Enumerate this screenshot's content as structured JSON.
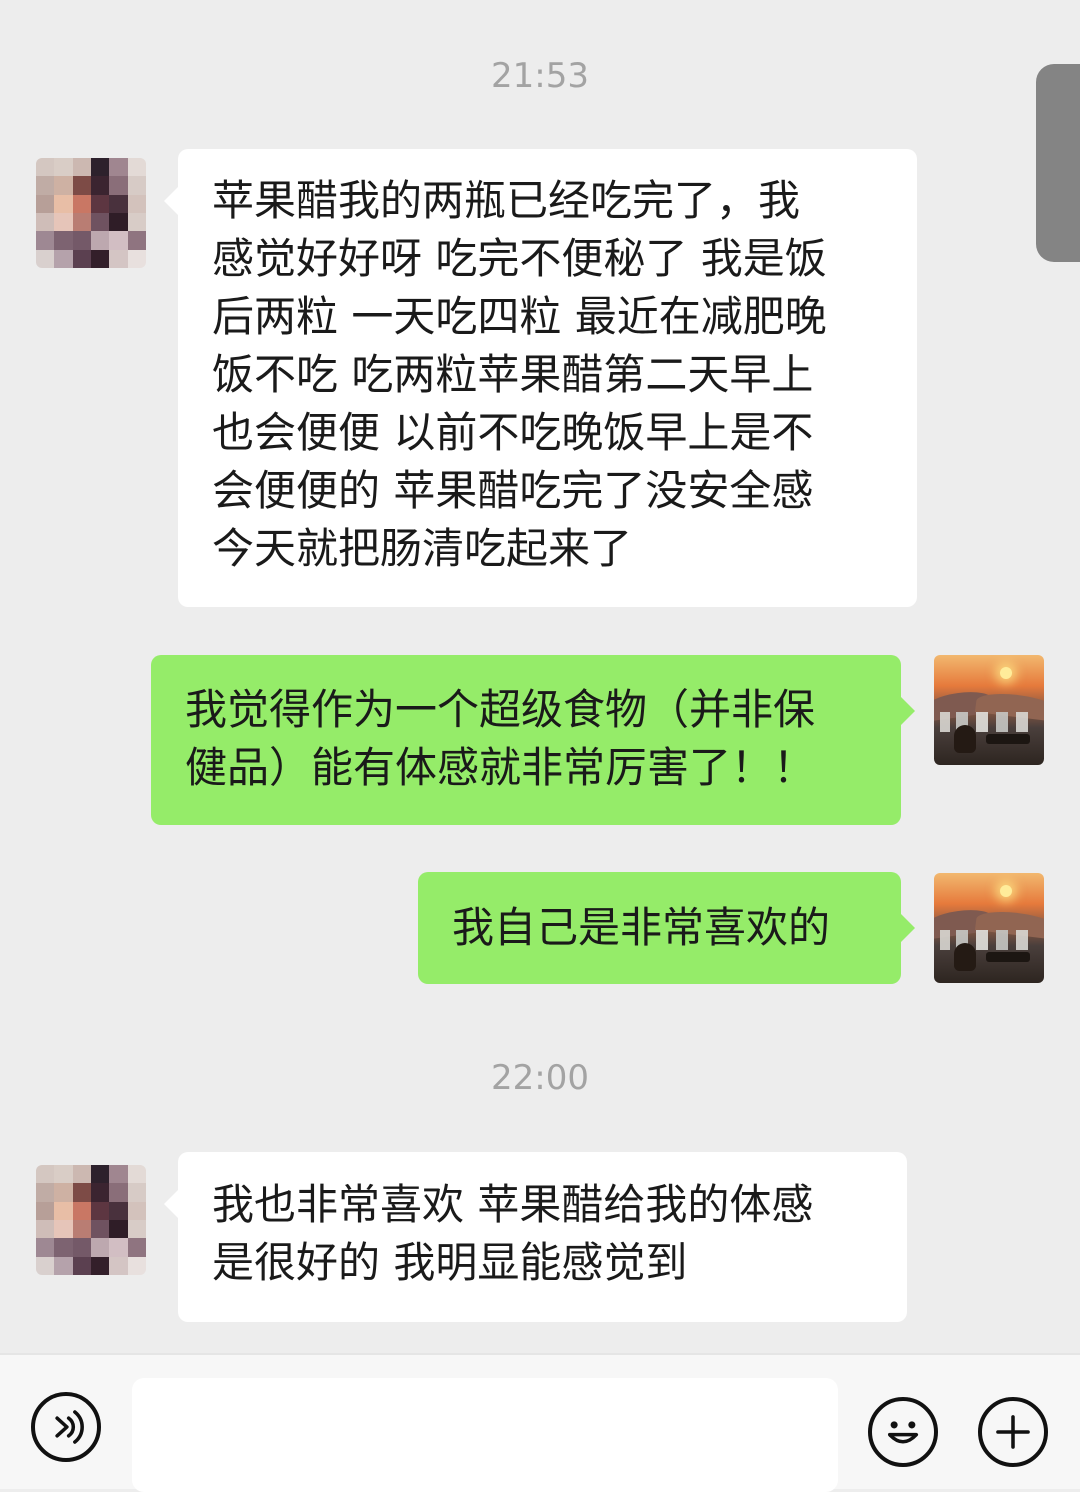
{
  "chat": {
    "timestamps": [
      "21:53",
      "22:00"
    ],
    "messages": [
      {
        "side": "left",
        "text": "苹果醋我的两瓶已经吃完了，我\n感觉好好呀 吃完不便秘了 我是饭\n后两粒 一天吃四粒 最近在减肥晚\n饭不吃 吃两粒苹果醋第二天早上\n也会便便 以前不吃晚饭早上是不\n会便便的  苹果醋吃完了没安全感\n今天就把肠清吃起来了"
      },
      {
        "side": "right",
        "text": "我觉得作为一个超级食物（并非保\n健品）能有体感就非常厉害了！！"
      },
      {
        "side": "right",
        "text": "我自己是非常喜欢的"
      },
      {
        "side": "left",
        "text": "我也非常喜欢 苹果醋给我的体感\n是很好的 我明显能感觉到"
      }
    ]
  },
  "composer": {
    "value": ""
  },
  "theme": {
    "background": "#ededed",
    "incoming_bubble": "#ffffff",
    "outgoing_bubble": "#95ec69",
    "timestamp_text": "#a3a3a3"
  },
  "icons": {
    "voice": "voice-icon",
    "emoji": "emoji-icon",
    "plus": "plus-icon",
    "more": "more-icon"
  }
}
